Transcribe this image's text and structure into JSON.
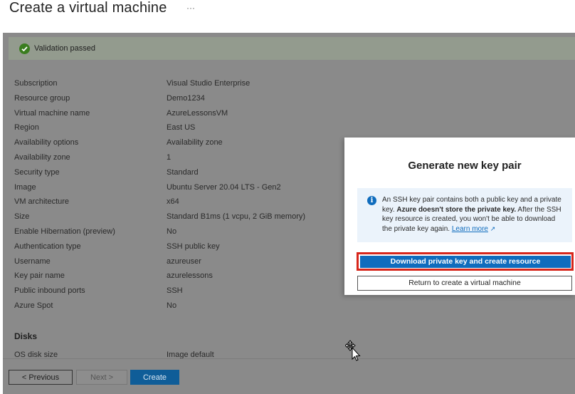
{
  "page": {
    "title": "Create a virtual machine",
    "more_icon": "ellipsis-icon",
    "more_text": "···"
  },
  "validation": {
    "icon": "check-circle-icon",
    "text": "Validation passed",
    "color": "#3a7d1f"
  },
  "summary": [
    {
      "label": "Subscription",
      "value": "Visual Studio Enterprise"
    },
    {
      "label": "Resource group",
      "value": "Demo1234"
    },
    {
      "label": "Virtual machine name",
      "value": "AzureLessonsVM"
    },
    {
      "label": "Region",
      "value": "East US"
    },
    {
      "label": "Availability options",
      "value": "Availability zone"
    },
    {
      "label": "Availability zone",
      "value": "1"
    },
    {
      "label": "Security type",
      "value": "Standard"
    },
    {
      "label": "Image",
      "value": "Ubuntu Server 20.04 LTS - Gen2"
    },
    {
      "label": "VM architecture",
      "value": "x64"
    },
    {
      "label": "Size",
      "value": "Standard B1ms (1 vcpu, 2 GiB memory)"
    },
    {
      "label": "Enable Hibernation (preview)",
      "value": "No"
    },
    {
      "label": "Authentication type",
      "value": "SSH public key"
    },
    {
      "label": "Username",
      "value": "azureuser"
    },
    {
      "label": "Key pair name",
      "value": "azurelessons"
    },
    {
      "label": "Public inbound ports",
      "value": "SSH"
    },
    {
      "label": "Azure Spot",
      "value": "No"
    }
  ],
  "disks": {
    "title": "Disks",
    "label": "OS disk size",
    "value": "Image default"
  },
  "footer": {
    "previous": "< Previous",
    "next": "Next >",
    "create": "Create"
  },
  "modal": {
    "title": "Generate new key pair",
    "info_icon": "info-icon",
    "info_pre": "An SSH key pair contains both a public key and a private key. ",
    "info_bold": "Azure doesn't store the private key.",
    "info_post": " After the SSH key resource is created, you won't be able to download the private key again. ",
    "learn_more": "Learn more",
    "external_icon": "external-link-icon",
    "download_button": "Download private key and create resource",
    "return_button": "Return to create a virtual machine"
  },
  "colors": {
    "accent": "#0f6cbd",
    "highlight_outline": "#d7261b",
    "overlay": "#8a8a8a"
  }
}
